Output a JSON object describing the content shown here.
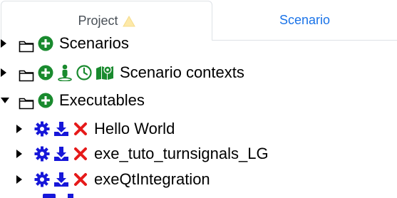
{
  "tabs": {
    "project_label": "Project",
    "scenario_label": "Scenario"
  },
  "tree": {
    "scenarios_label": "Scenarios",
    "scenario_contexts_label": "Scenario contexts",
    "executables_label": "Executables",
    "executables": [
      {
        "label": "Hello World"
      },
      {
        "label": "exe_tuto_turnsignals_LG"
      },
      {
        "label": "exeQtIntegration"
      }
    ]
  },
  "colors": {
    "add": "#198a2e",
    "action_blue": "#1717d9",
    "delete_red": "#e61a1a",
    "tab_link": "#1a73e8",
    "warning": "#fde9a8"
  }
}
